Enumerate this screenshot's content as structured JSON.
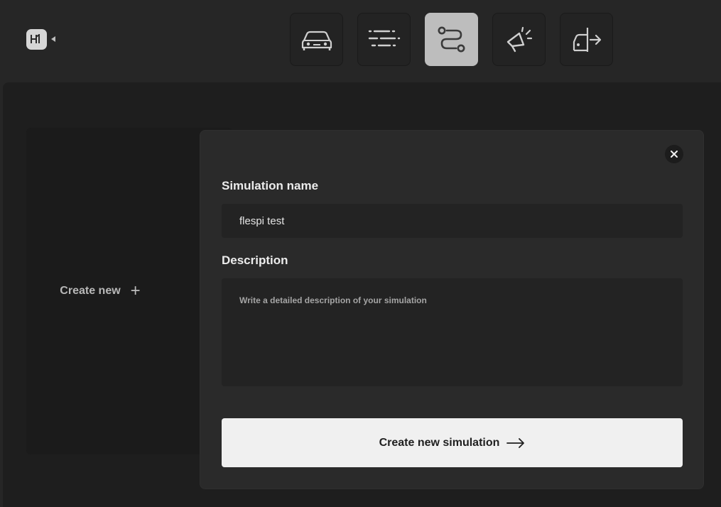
{
  "header": {
    "logo_icon": "hardware-logo-icon",
    "nav": [
      {
        "name": "vehicle",
        "icon": "car-icon",
        "active": false
      },
      {
        "name": "parameters",
        "icon": "sliders-icon",
        "active": false
      },
      {
        "name": "route",
        "icon": "route-icon",
        "active": true
      },
      {
        "name": "events",
        "icon": "megaphone-icon",
        "active": false
      },
      {
        "name": "export",
        "icon": "car-export-icon",
        "active": false
      }
    ]
  },
  "sidebar": {
    "create_label": "Create new",
    "create_icon": "plus-icon"
  },
  "modal": {
    "name_label": "Simulation name",
    "name_value": "flespi test",
    "description_label": "Description",
    "description_placeholder": "Write a detailed description of your simulation",
    "description_value": "",
    "submit_label": "Create new simulation",
    "close_icon": "close-icon"
  },
  "colors": {
    "background": "#262626",
    "panel": "#2a2a2a",
    "active_nav": "#bdbdbd",
    "button": "#f0f0f0"
  }
}
